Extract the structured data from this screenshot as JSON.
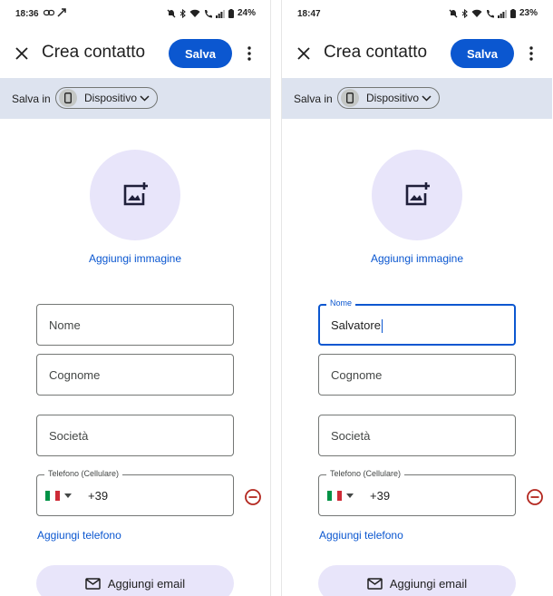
{
  "screens": [
    {
      "status": {
        "time": "18:36",
        "battery": "24%"
      },
      "appbar": {
        "title": "Crea contatto",
        "save_label": "Salva"
      },
      "save_in": {
        "label": "Salva in",
        "device": "Dispositivo"
      },
      "add_image_label": "Aggiungi immagine",
      "fields": {
        "nome": {
          "placeholder": "Nome",
          "value": ""
        },
        "cognome": {
          "placeholder": "Cognome"
        },
        "societa": {
          "placeholder": "Società"
        },
        "telefono": {
          "label": "Telefono (Cellulare)",
          "prefix": "+39"
        }
      },
      "add_phone_label": "Aggiungi telefono",
      "add_email_label": "Aggiungi email"
    },
    {
      "status": {
        "time": "18:47",
        "battery": "23%"
      },
      "appbar": {
        "title": "Crea contatto",
        "save_label": "Salva"
      },
      "save_in": {
        "label": "Salva in",
        "device": "Dispositivo"
      },
      "add_image_label": "Aggiungi immagine",
      "fields": {
        "nome": {
          "label": "Nome",
          "value": "Salvatore"
        },
        "cognome": {
          "placeholder": "Cognome"
        },
        "societa": {
          "placeholder": "Società"
        },
        "telefono": {
          "label": "Telefono (Cellulare)",
          "prefix": "+39"
        }
      },
      "add_phone_label": "Aggiungi telefono",
      "add_email_label": "Aggiungi email"
    }
  ],
  "colors": {
    "primary": "#0b57d0",
    "savebar_bg": "#dde3ef",
    "avatar_bg": "#e8e5fa",
    "remove_red": "#b3261e"
  },
  "icons": {
    "close": "close-icon",
    "more": "more-vert-icon",
    "add_photo": "add-photo-icon",
    "phone": "phone-icon",
    "chevron": "chevron-down-icon",
    "mail": "mail-icon",
    "remove": "remove-circle-icon",
    "flag": "italy-flag-icon"
  }
}
